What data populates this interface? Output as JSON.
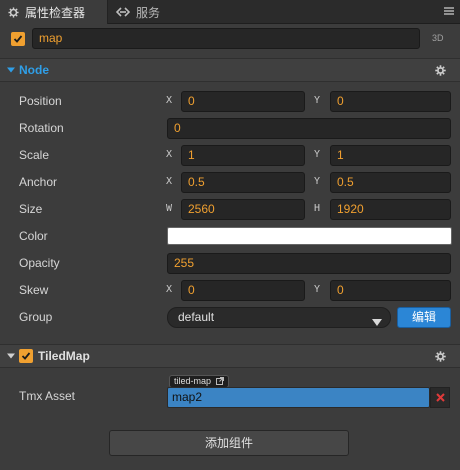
{
  "tabs": [
    {
      "label": "属性检查器",
      "icon": "gear-icon",
      "active": true
    },
    {
      "label": "服务",
      "icon": "link-icon",
      "active": false
    }
  ],
  "node_header": {
    "enabled": true,
    "name": "map",
    "badge": "3D"
  },
  "node_section": {
    "title": "Node",
    "expanded": true
  },
  "properties": {
    "position": {
      "label": "Position",
      "x_axis": "X",
      "x": "0",
      "y_axis": "Y",
      "y": "0"
    },
    "rotation": {
      "label": "Rotation",
      "value": "0"
    },
    "scale": {
      "label": "Scale",
      "x_axis": "X",
      "x": "1",
      "y_axis": "Y",
      "y": "1"
    },
    "anchor": {
      "label": "Anchor",
      "x_axis": "X",
      "x": "0.5",
      "y_axis": "Y",
      "y": "0.5"
    },
    "size": {
      "label": "Size",
      "w_axis": "W",
      "w": "2560",
      "h_axis": "H",
      "h": "1920"
    },
    "color": {
      "label": "Color",
      "value": "#ffffff"
    },
    "opacity": {
      "label": "Opacity",
      "value": "255"
    },
    "skew": {
      "label": "Skew",
      "x_axis": "X",
      "x": "0",
      "y_axis": "Y",
      "y": "0"
    },
    "group": {
      "label": "Group",
      "value": "default",
      "edit_label": "编辑"
    }
  },
  "tiledmap_section": {
    "title": "TiledMap",
    "enabled": true,
    "expanded": true
  },
  "tmx": {
    "label": "Tmx Asset",
    "tag": "tiled-map",
    "value": "map2"
  },
  "add_component_label": "添加组件",
  "colors": {
    "accent": "#f0a030",
    "node_title": "#2f9fe8",
    "asset_field": "#3b84c4",
    "edit_button": "#2b86d6"
  }
}
